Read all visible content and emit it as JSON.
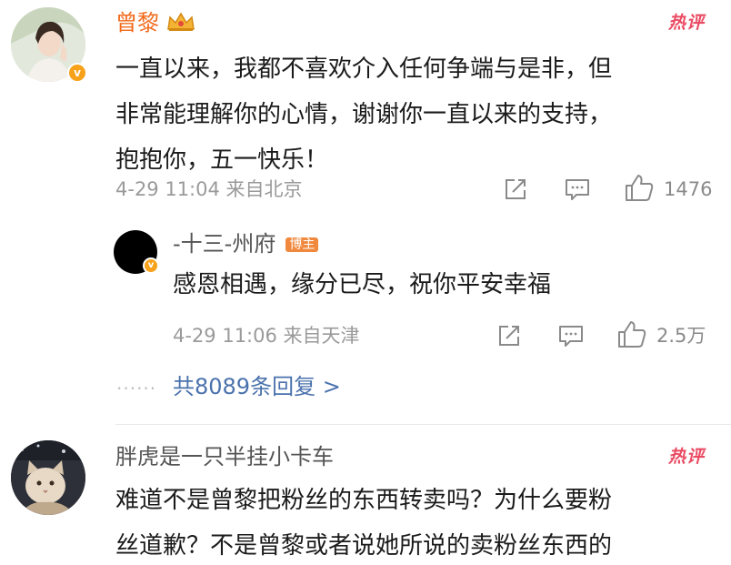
{
  "comments": [
    {
      "user": "曾黎",
      "text_lines": [
        "一直以来，我都不喜欢介入任何争端与是非，但",
        "非常能理解你的心情，谢谢你一直以来的支持，",
        "抱抱你，五一快乐！"
      ],
      "hot_label": "热评",
      "meta": "4-29 11:04 来自北京",
      "likes": "1476"
    },
    {
      "user": "胖虎是一只半挂小卡车",
      "text_lines": [
        "难道不是曾黎把粉丝的东西转卖吗？为什么要粉",
        "丝道歉？不是曾黎或者说她所说的卖粉丝东西的"
      ],
      "hot_label": "热评"
    }
  ],
  "reply": {
    "user": "-十三-州府",
    "tag": "博主",
    "text": "感恩相遇，缘分已尽，祝你平安幸福",
    "meta": "4-29 11:06 来自天津",
    "likes": "2.5万"
  },
  "more_replies": "共8089条回复 >",
  "more_dots": "······",
  "colors": {
    "accent_orange": "#f26b1d",
    "link_blue": "#4a72ad",
    "hot_red": "#ea4b63",
    "verified_gold": "#f7a21a"
  }
}
